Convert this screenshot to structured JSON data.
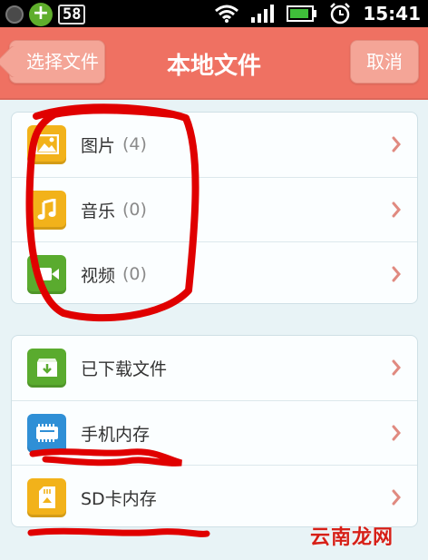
{
  "status_bar": {
    "badge": "58",
    "time": "15:41"
  },
  "header": {
    "back_label": "选择文件",
    "title": "本地文件",
    "cancel_label": "取消"
  },
  "media_group": [
    {
      "label": "图片",
      "count": "(4)",
      "icon": "image-icon",
      "color": "#f2b21a"
    },
    {
      "label": "音乐",
      "count": "(0)",
      "icon": "music-icon",
      "color": "#f2b21a"
    },
    {
      "label": "视频",
      "count": "(0)",
      "icon": "video-icon",
      "color": "#5aab2e"
    }
  ],
  "storage_group": [
    {
      "label": "已下载文件",
      "icon": "download-box-icon",
      "color": "#5aab2e"
    },
    {
      "label": "手机内存",
      "icon": "phone-memory-icon",
      "color": "#2f8fd6"
    },
    {
      "label": "SD卡内存",
      "icon": "sd-card-icon",
      "color": "#f2b21a"
    }
  ],
  "watermark": "云南龙网",
  "colors": {
    "header_bg": "#ef7162",
    "accent_chevron": "#e08a80",
    "scribble": "#e00000"
  }
}
